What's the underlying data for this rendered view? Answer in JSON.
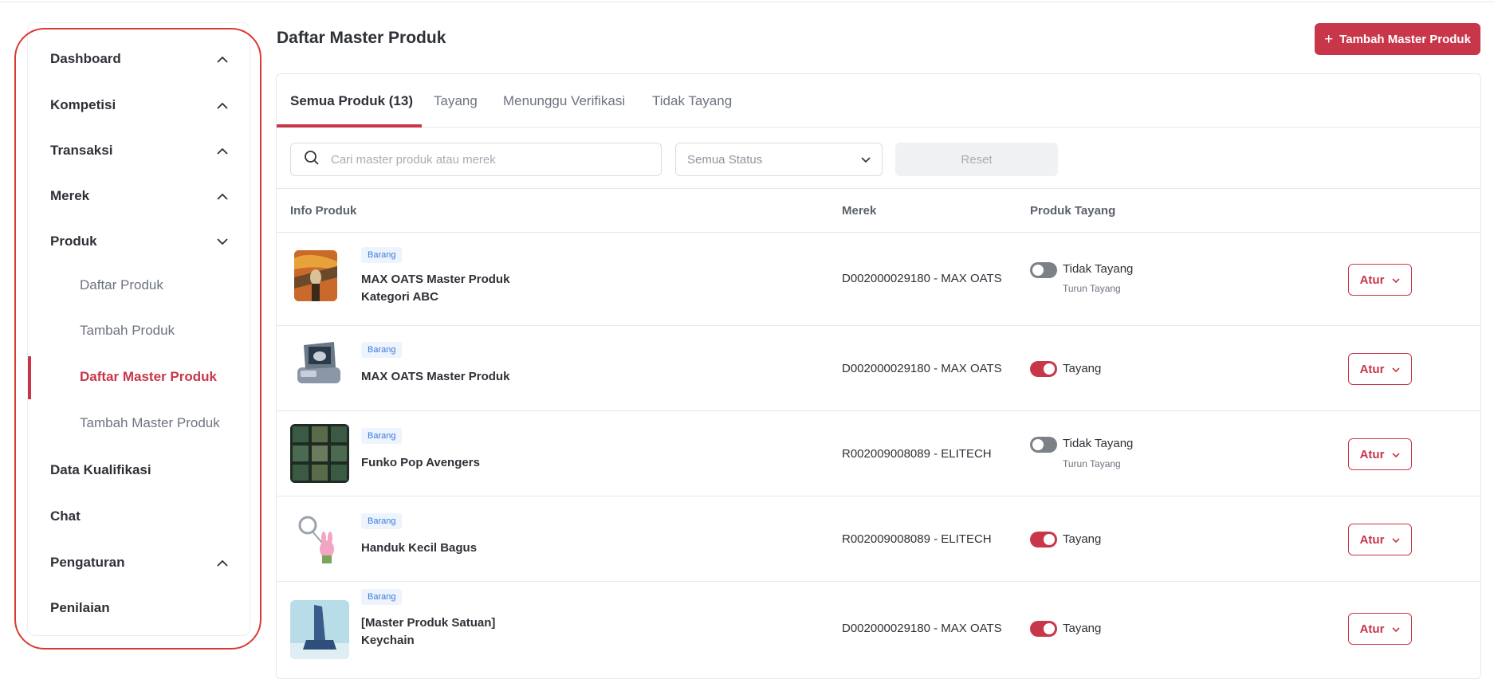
{
  "sidebar": {
    "items": [
      {
        "label": "Dashboard"
      },
      {
        "label": "Kompetisi"
      },
      {
        "label": "Transaksi"
      },
      {
        "label": "Merek"
      },
      {
        "label": "Produk"
      },
      {
        "label": "Data Kualifikasi"
      },
      {
        "label": "Chat"
      },
      {
        "label": "Pengaturan"
      },
      {
        "label": "Penilaian"
      }
    ],
    "produk_sub": [
      {
        "label": "Daftar Produk"
      },
      {
        "label": "Tambah Produk"
      },
      {
        "label": "Daftar Master Produk",
        "active": true
      },
      {
        "label": "Tambah Master Produk"
      }
    ]
  },
  "header": {
    "title": "Daftar Master Produk",
    "add_button": "Tambah Master Produk"
  },
  "tabs": [
    {
      "label": "Semua Produk (13)",
      "active": true
    },
    {
      "label": "Tayang"
    },
    {
      "label": "Menunggu Verifikasi"
    },
    {
      "label": "Tidak Tayang"
    }
  ],
  "filters": {
    "search_placeholder": "Cari master produk atau merek",
    "status_selected": "Semua Status",
    "reset_label": "Reset"
  },
  "table": {
    "columns": [
      "Info Produk",
      "Merek",
      "Produk Tayang"
    ],
    "rows": [
      {
        "badge": "Barang",
        "name": "MAX OATS Master Produk Kategori ABC",
        "brand": "D002000029180 - MAX OATS",
        "status": "Tidak Tayang",
        "substatus": "Turun Tayang",
        "live": false,
        "action": "Atur",
        "thumb": "painting"
      },
      {
        "badge": "Barang",
        "name": "MAX OATS Master Produk",
        "brand": "D002000029180 - MAX OATS",
        "status": "Tayang",
        "substatus": "",
        "live": true,
        "action": "Atur",
        "thumb": "device"
      },
      {
        "badge": "Barang",
        "name": "Funko Pop Avengers",
        "brand": "R002009008089 - ELITECH",
        "status": "Tidak Tayang",
        "substatus": "Turun Tayang",
        "live": false,
        "action": "Atur",
        "thumb": "boxes"
      },
      {
        "badge": "Barang",
        "name": "Handuk Kecil Bagus",
        "brand": "R002009008089 - ELITECH",
        "status": "Tayang",
        "substatus": "",
        "live": true,
        "action": "Atur",
        "thumb": "keychain"
      },
      {
        "badge": "Barang",
        "name": "[Master Produk Satuan] Keychain",
        "brand": "D002000029180 - MAX OATS",
        "status": "Tayang",
        "substatus": "",
        "live": true,
        "action": "Atur",
        "thumb": "shoe"
      }
    ]
  },
  "colors": {
    "accent": "#c8364a",
    "highlight": "#d93a30",
    "badge_text": "#3b7ad9",
    "toggle_off": "#7b8089"
  }
}
